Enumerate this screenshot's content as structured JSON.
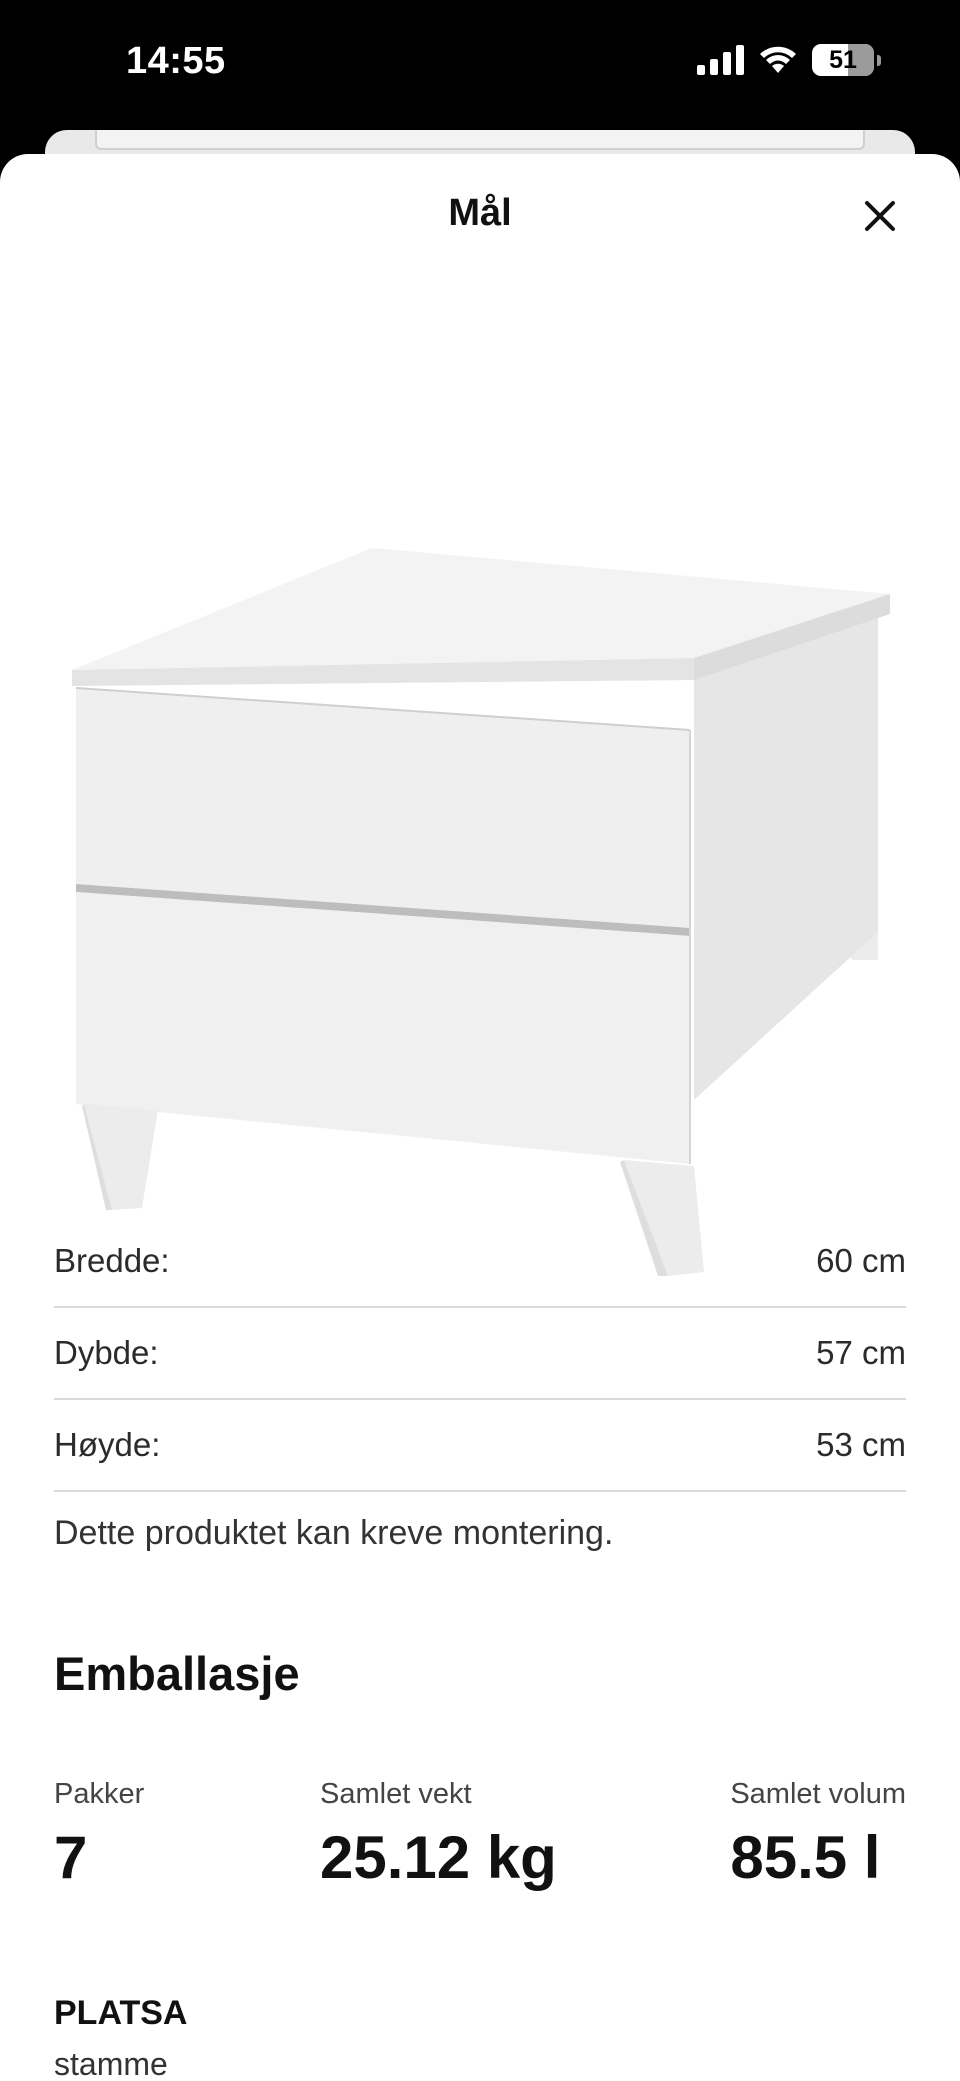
{
  "status_bar": {
    "time": "14:55",
    "battery_level": "51",
    "icons": [
      "cellular-signal-icon",
      "wifi-icon",
      "battery-icon"
    ]
  },
  "sheet": {
    "title": "Mål",
    "close_icon": "close-icon",
    "image_description_name": "drawer-chest-image"
  },
  "dimensions": [
    {
      "label": "Bredde:",
      "value": "60 cm"
    },
    {
      "label": "Dybde:",
      "value": "57 cm"
    },
    {
      "label": "Høyde:",
      "value": "53 cm"
    }
  ],
  "assembly_note": "Dette produktet kan kreve montering.",
  "packaging": {
    "title": "Emballasje",
    "packages_label": "Pakker",
    "packages_value": "7",
    "weight_label": "Samlet vekt",
    "weight_value": "25.12 kg",
    "volume_label": "Samlet volum",
    "volume_value": "85.5 l"
  },
  "product": {
    "name": "PLATSA",
    "subtitle": "stamme"
  },
  "colors": {
    "background": "#ffffff",
    "text": "#111111",
    "divider": "#dadada"
  }
}
